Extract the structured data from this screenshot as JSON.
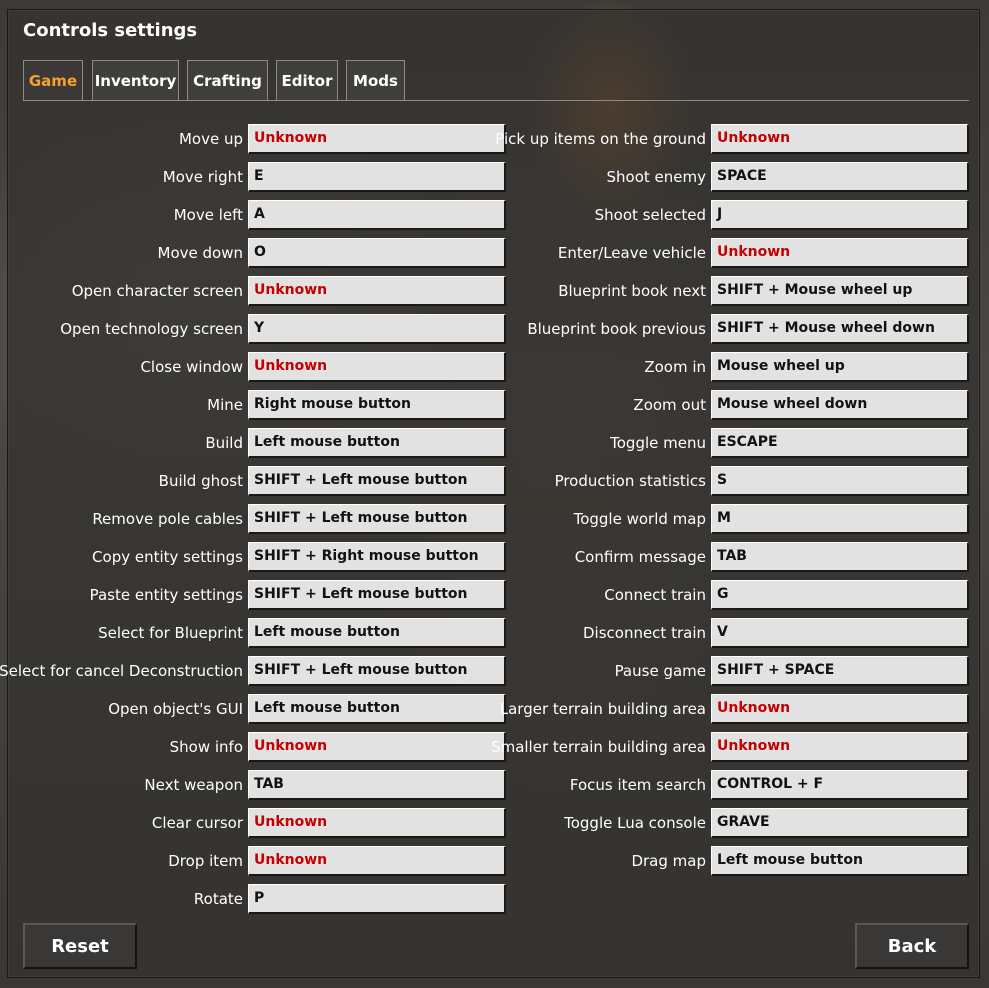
{
  "window": {
    "title": "Controls settings"
  },
  "tabs": [
    {
      "label": "Game",
      "active": true
    },
    {
      "label": "Inventory",
      "active": false
    },
    {
      "label": "Crafting",
      "active": false
    },
    {
      "label": "Editor",
      "active": false
    },
    {
      "label": "Mods",
      "active": false
    }
  ],
  "left_controls": [
    {
      "label": "Move up",
      "value": "Unknown",
      "unknown": true
    },
    {
      "label": "Move right",
      "value": "E",
      "unknown": false
    },
    {
      "label": "Move left",
      "value": "A",
      "unknown": false
    },
    {
      "label": "Move down",
      "value": "O",
      "unknown": false
    },
    {
      "label": "Open character screen",
      "value": "Unknown",
      "unknown": true
    },
    {
      "label": "Open technology screen",
      "value": "Y",
      "unknown": false
    },
    {
      "label": "Close window",
      "value": "Unknown",
      "unknown": true
    },
    {
      "label": "Mine",
      "value": "Right mouse button",
      "unknown": false
    },
    {
      "label": "Build",
      "value": "Left mouse button",
      "unknown": false
    },
    {
      "label": "Build ghost",
      "value": "SHIFT + Left mouse button",
      "unknown": false
    },
    {
      "label": "Remove pole cables",
      "value": "SHIFT + Left mouse button",
      "unknown": false
    },
    {
      "label": "Copy entity settings",
      "value": "SHIFT + Right mouse button",
      "unknown": false
    },
    {
      "label": "Paste entity settings",
      "value": "SHIFT + Left mouse button",
      "unknown": false
    },
    {
      "label": "Select for Blueprint",
      "value": "Left mouse button",
      "unknown": false
    },
    {
      "label": "Select for cancel Deconstruction",
      "value": "SHIFT + Left mouse button",
      "unknown": false
    },
    {
      "label": "Open object's GUI",
      "value": "Left mouse button",
      "unknown": false
    },
    {
      "label": "Show info",
      "value": "Unknown",
      "unknown": true
    },
    {
      "label": "Next weapon",
      "value": "TAB",
      "unknown": false
    },
    {
      "label": "Clear cursor",
      "value": "Unknown",
      "unknown": true
    },
    {
      "label": "Drop item",
      "value": "Unknown",
      "unknown": true
    },
    {
      "label": "Rotate",
      "value": "P",
      "unknown": false
    }
  ],
  "right_controls": [
    {
      "label": "Pick up items on the ground",
      "value": "Unknown",
      "unknown": true
    },
    {
      "label": "Shoot enemy",
      "value": "SPACE",
      "unknown": false
    },
    {
      "label": "Shoot selected",
      "value": "J",
      "unknown": false
    },
    {
      "label": "Enter/Leave vehicle",
      "value": "Unknown",
      "unknown": true
    },
    {
      "label": "Blueprint book next",
      "value": "SHIFT + Mouse wheel up",
      "unknown": false
    },
    {
      "label": "Blueprint book previous",
      "value": "SHIFT + Mouse wheel down",
      "unknown": false
    },
    {
      "label": "Zoom in",
      "value": "Mouse wheel up",
      "unknown": false
    },
    {
      "label": "Zoom out",
      "value": "Mouse wheel down",
      "unknown": false
    },
    {
      "label": "Toggle menu",
      "value": "ESCAPE",
      "unknown": false
    },
    {
      "label": "Production statistics",
      "value": "S",
      "unknown": false
    },
    {
      "label": "Toggle world map",
      "value": "M",
      "unknown": false
    },
    {
      "label": "Confirm message",
      "value": "TAB",
      "unknown": false
    },
    {
      "label": "Connect train",
      "value": "G",
      "unknown": false
    },
    {
      "label": "Disconnect train",
      "value": "V",
      "unknown": false
    },
    {
      "label": "Pause game",
      "value": "SHIFT + SPACE",
      "unknown": false
    },
    {
      "label": "Larger terrain building area",
      "value": "Unknown",
      "unknown": true
    },
    {
      "label": "Smaller terrain building area",
      "value": "Unknown",
      "unknown": true
    },
    {
      "label": "Focus item search",
      "value": "CONTROL + F",
      "unknown": false
    },
    {
      "label": "Toggle Lua console",
      "value": "GRAVE",
      "unknown": false
    },
    {
      "label": "Drag map",
      "value": "Left mouse button",
      "unknown": false
    }
  ],
  "buttons": {
    "reset_label": "Reset",
    "back_label": "Back"
  },
  "colors": {
    "accent_active_tab": "#f4a22d",
    "unknown_binding": "#c50000",
    "key_field": "#e2e2e2"
  }
}
